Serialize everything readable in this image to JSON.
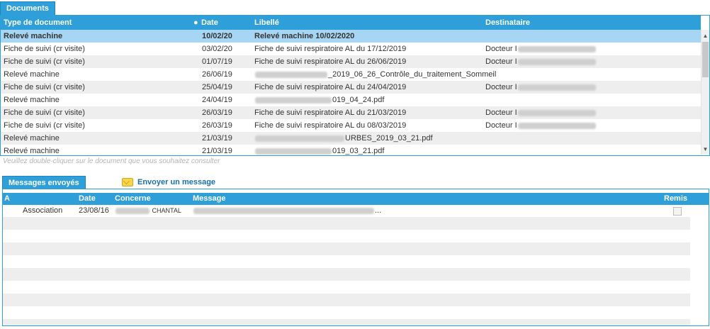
{
  "documents": {
    "tab_label": "Documents",
    "headers": {
      "type": "Type de document",
      "date": "Date",
      "libelle": "Libellé",
      "destinataire": "Destinataire"
    },
    "rows": [
      {
        "type": "Relevé machine",
        "date": "10/02/20",
        "libelle": "Relevé machine 10/02/2020",
        "dest": ""
      },
      {
        "type": "Fiche de suivi (cr visite)",
        "date": "03/02/20",
        "libelle": "Fiche de suivi respiratoire AL du 17/12/2019",
        "dest": "Docteur I"
      },
      {
        "type": "Fiche de suivi (cr visite)",
        "date": "01/07/19",
        "libelle": "Fiche de suivi respiratoire AL du 26/06/2019",
        "dest": "Docteur I"
      },
      {
        "type": "Relevé machine",
        "date": "26/06/19",
        "libelle": "_2019_06_26_Contrôle_du_traitement_Sommeil",
        "dest": ""
      },
      {
        "type": "Fiche de suivi (cr visite)",
        "date": "25/04/19",
        "libelle": "Fiche de suivi respiratoire AL du 24/04/2019",
        "dest": "Docteur I"
      },
      {
        "type": "Relevé machine",
        "date": "24/04/19",
        "libelle": "019_04_24.pdf",
        "dest": ""
      },
      {
        "type": "Fiche de suivi (cr visite)",
        "date": "26/03/19",
        "libelle": "Fiche de suivi respiratoire AL du 21/03/2019",
        "dest": "Docteur I"
      },
      {
        "type": "Fiche de suivi (cr visite)",
        "date": "26/03/19",
        "libelle": "Fiche de suivi respiratoire AL du 08/03/2019",
        "dest": "Docteur I"
      },
      {
        "type": "Relevé machine",
        "date": "21/03/19",
        "libelle": "URBES_2019_03_21.pdf",
        "dest": ""
      },
      {
        "type": "Relevé machine",
        "date": "21/03/19",
        "libelle": "019_03_21.pdf",
        "dest": ""
      }
    ],
    "hint": "Veuillez double-cliquer sur le document que vous souhaitez consulter"
  },
  "messages": {
    "tab_label": "Messages envoyés",
    "send_label": "Envoyer un message",
    "headers": {
      "a": "A",
      "date": "Date",
      "concerne": "Concerne",
      "message": "Message",
      "remis": "Remis"
    },
    "rows": [
      {
        "a": "Association",
        "date": "23/08/16",
        "concerne": "CHANTAL",
        "message": "..."
      }
    ]
  }
}
